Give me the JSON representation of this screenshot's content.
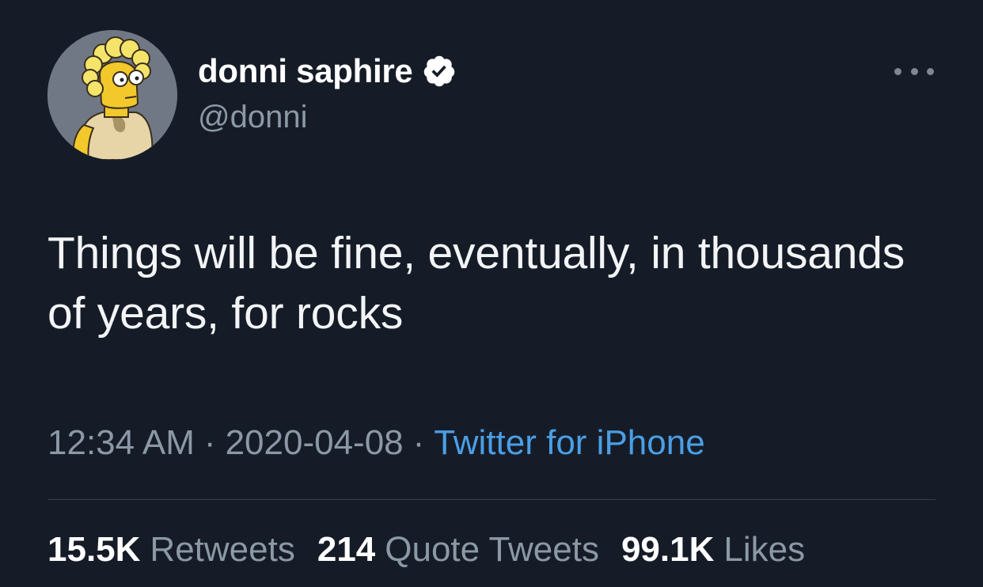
{
  "author": {
    "display_name": "donni saphire",
    "handle": "@donni",
    "verified": true,
    "avatar": "cartoon-character-avatar"
  },
  "tweet": {
    "text": "Things will be fine, eventually, in thousands of years, for rocks"
  },
  "meta": {
    "time": "12:34 AM",
    "separator": "·",
    "date": "2020-04-08",
    "source": "Twitter for iPhone"
  },
  "stats": [
    {
      "count": "15.5K",
      "label": "Retweets"
    },
    {
      "count": "214",
      "label": "Quote Tweets"
    },
    {
      "count": "99.1K",
      "label": "Likes"
    }
  ],
  "colors": {
    "background": "#161c27",
    "text_primary": "#ffffff",
    "text_secondary": "#8b98a5",
    "link": "#4a9fe6",
    "divider": "#37404c"
  },
  "icons": {
    "verified": "verified-badge-icon",
    "more": "more-options-icon"
  }
}
